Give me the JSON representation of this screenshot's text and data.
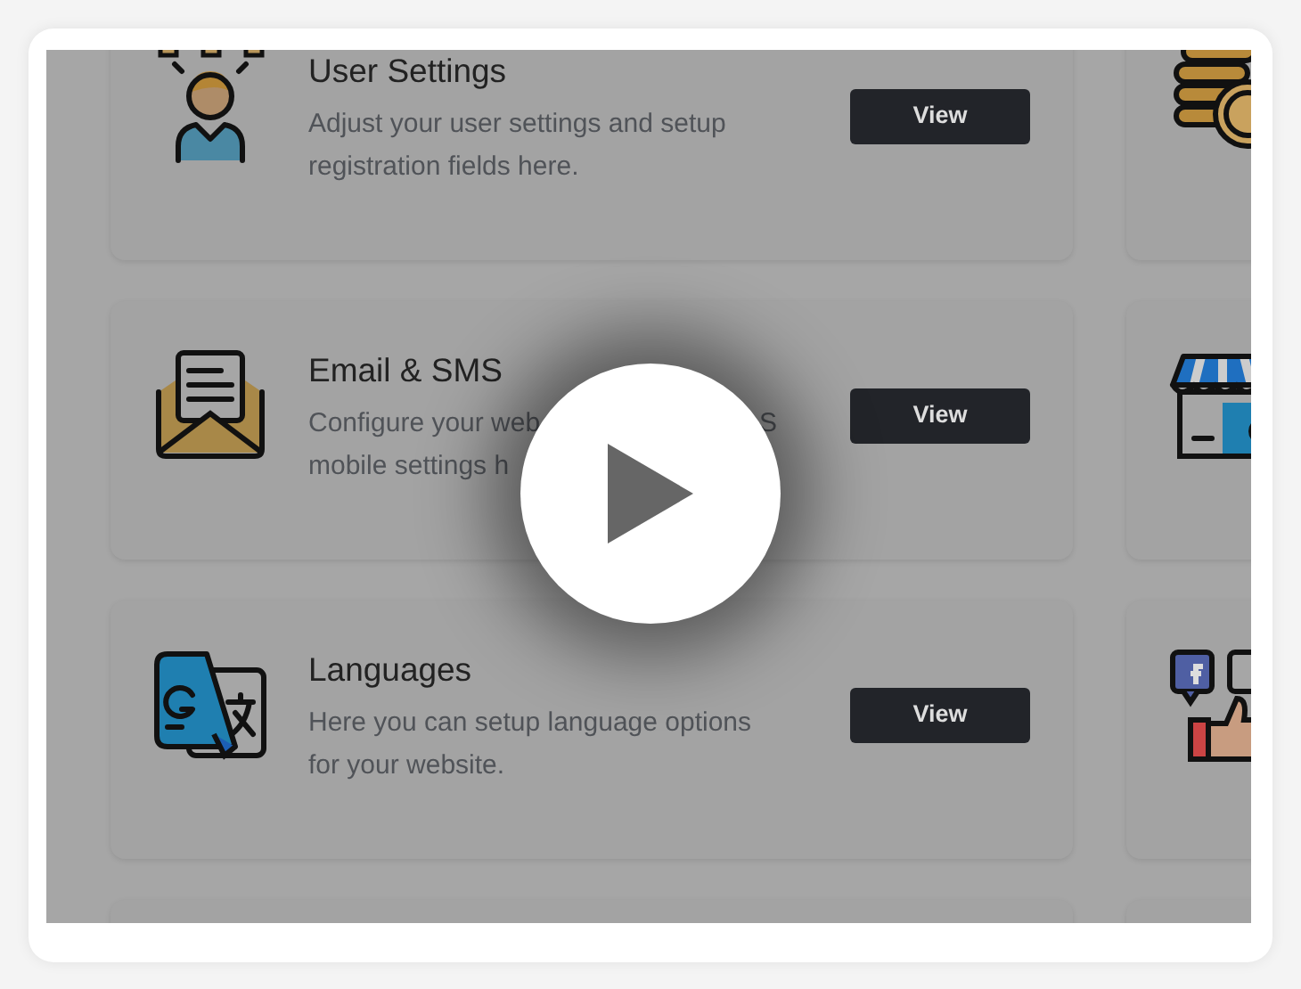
{
  "cards": [
    {
      "title": "User Settings",
      "lines": [
        [
          "Adjust your user settings and setup"
        ],
        [
          "registration fields here."
        ]
      ],
      "button": "View"
    },
    {
      "title": "Email & SMS",
      "lines": [
        [
          "Configure your web",
          "S"
        ],
        [
          "mobile settings h"
        ]
      ],
      "button": "View"
    },
    {
      "title": "Languages",
      "lines": [
        [
          "Here you can setup language options"
        ],
        [
          "for your website."
        ]
      ],
      "button": "View"
    }
  ]
}
